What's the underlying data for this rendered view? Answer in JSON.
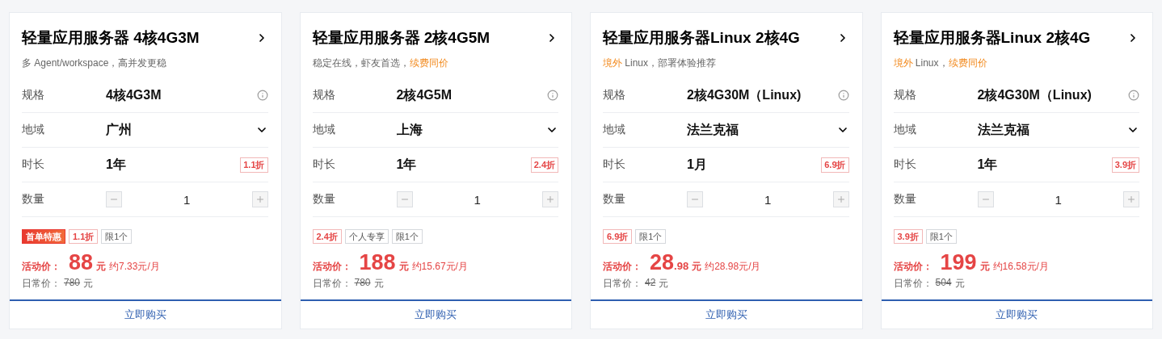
{
  "cards": [
    {
      "title": "轻量应用服务器 4核4G3M",
      "subtitle": [
        {
          "text": "多 Agent/workspace，高并发更稳",
          "highlight": false
        }
      ],
      "spec_label": "规格",
      "spec": "4核4G3M",
      "region_label": "地域",
      "region": "广州",
      "duration_label": "时长",
      "duration": "1年",
      "duration_discount": "1.1折",
      "quantity_label": "数量",
      "quantity": "1",
      "tags": [
        {
          "kind": "hot",
          "text": "首单特惠"
        },
        {
          "kind": "discount",
          "text": "1.1折"
        },
        {
          "kind": "plain",
          "text": "限1个"
        }
      ],
      "promo_label": "活动价：",
      "price": "88",
      "unit": "元",
      "monthly": "约7.33元/月",
      "regular_label": "日常价：",
      "regular_price": "780",
      "regular_unit": "元",
      "buy": "立即购买"
    },
    {
      "title": "轻量应用服务器 2核4G5M",
      "subtitle": [
        {
          "text": "稳定在线，虾友首选，",
          "highlight": false
        },
        {
          "text": "续费同价",
          "highlight": true
        }
      ],
      "spec_label": "规格",
      "spec": "2核4G5M",
      "region_label": "地域",
      "region": "上海",
      "duration_label": "时长",
      "duration": "1年",
      "duration_discount": "2.4折",
      "quantity_label": "数量",
      "quantity": "1",
      "tags": [
        {
          "kind": "discount",
          "text": "2.4折"
        },
        {
          "kind": "plain",
          "text": "个人专享"
        },
        {
          "kind": "plain",
          "text": "限1个"
        }
      ],
      "promo_label": "活动价：",
      "price": "188",
      "unit": "元",
      "monthly": "约15.67元/月",
      "regular_label": "日常价：",
      "regular_price": "780",
      "regular_unit": "元",
      "buy": "立即购买"
    },
    {
      "title": "轻量应用服务器Linux 2核4G",
      "subtitle": [
        {
          "text": "境外",
          "highlight": true
        },
        {
          "text": " Linux，部署体验推荐",
          "highlight": false
        }
      ],
      "spec_label": "规格",
      "spec": "2核4G30M（Linux)",
      "region_label": "地域",
      "region": "法兰克福",
      "duration_label": "时长",
      "duration": "1月",
      "duration_discount": "6.9折",
      "quantity_label": "数量",
      "quantity": "1",
      "tags": [
        {
          "kind": "discount",
          "text": "6.9折"
        },
        {
          "kind": "plain",
          "text": "限1个"
        }
      ],
      "promo_label": "活动价：",
      "price": "28",
      "price_decimal": ".98",
      "unit": "元",
      "monthly": "约28.98元/月",
      "regular_label": "日常价：",
      "regular_price": "42",
      "regular_unit": "元",
      "buy": "立即购买"
    },
    {
      "title": "轻量应用服务器Linux 2核4G",
      "subtitle": [
        {
          "text": "境外",
          "highlight": true
        },
        {
          "text": " Linux，",
          "highlight": false
        },
        {
          "text": "续费同价",
          "highlight": true
        }
      ],
      "spec_label": "规格",
      "spec": "2核4G30M（Linux)",
      "region_label": "地域",
      "region": "法兰克福",
      "duration_label": "时长",
      "duration": "1年",
      "duration_discount": "3.9折",
      "quantity_label": "数量",
      "quantity": "1",
      "tags": [
        {
          "kind": "discount",
          "text": "3.9折"
        },
        {
          "kind": "plain",
          "text": "限1个"
        }
      ],
      "promo_label": "活动价：",
      "price": "199",
      "unit": "元",
      "monthly": "约16.58元/月",
      "regular_label": "日常价：",
      "regular_price": "504",
      "regular_unit": "元",
      "buy": "立即购买"
    }
  ]
}
